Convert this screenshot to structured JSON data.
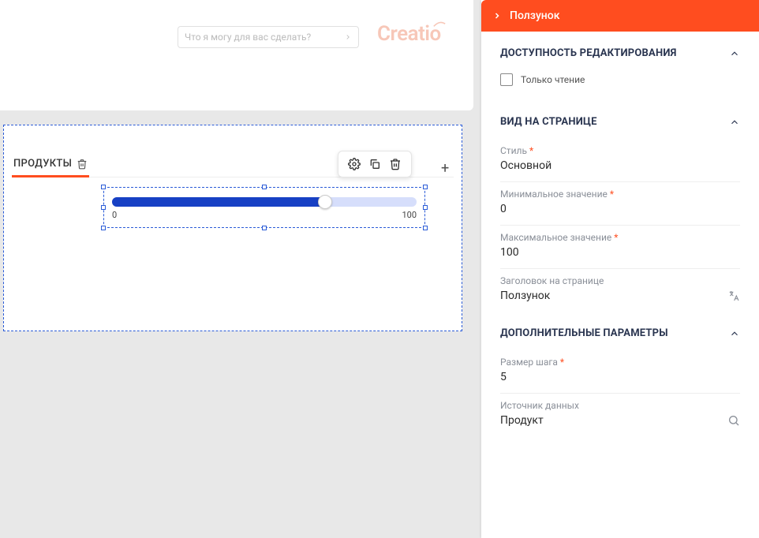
{
  "header": {
    "search_placeholder": "Что я могу для вас сделать?",
    "logo_text": "Creatio"
  },
  "canvas": {
    "tab_label": "ПРОДУКТЫ",
    "slider": {
      "min_label": "0",
      "max_label": "100"
    }
  },
  "panel": {
    "title": "Ползунок",
    "sections": {
      "access": {
        "title": "ДОСТУПНОСТЬ РЕДАКТИРОВАНИЯ",
        "readonly_label": "Только чтение"
      },
      "view": {
        "title": "ВИД НА СТРАНИЦЕ",
        "style_label": "Стиль",
        "style_value": "Основной",
        "min_label": "Минимальное значение",
        "min_value": "0",
        "max_label": "Максимальное значение",
        "max_value": "100",
        "title_label": "Заголовок на странице",
        "title_value": "Ползунок"
      },
      "params": {
        "title": "ДОПОЛНИТЕЛЬНЫЕ ПАРАМЕТРЫ",
        "step_label": "Размер шага",
        "step_value": "5",
        "source_label": "Источник данных",
        "source_value": "Продукт"
      }
    }
  }
}
